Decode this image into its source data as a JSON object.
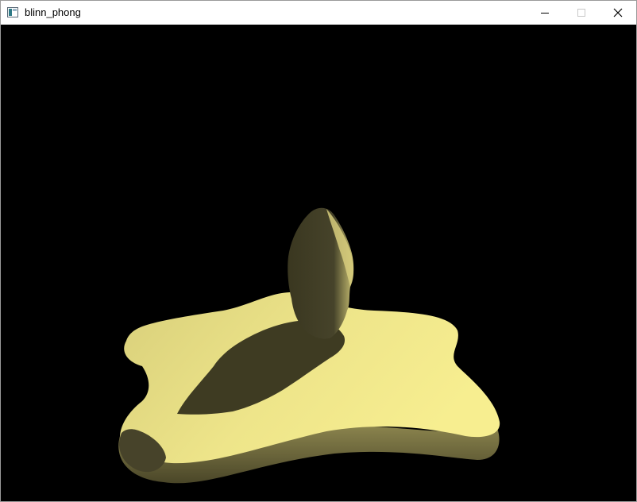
{
  "window": {
    "title": "blinn_phong",
    "app_icon": "window-app-icon",
    "controls": {
      "minimize_icon": "minimize-icon",
      "maximize_icon": "maximize-icon",
      "close_icon": "close-icon"
    }
  },
  "viewport": {
    "background": "#000000",
    "scene": "shaded-mesh-with-shadow",
    "colors": {
      "surface_lit": "#f2ea8e",
      "surface_mid": "#c9c070",
      "shadow": "#3e3b23"
    }
  }
}
